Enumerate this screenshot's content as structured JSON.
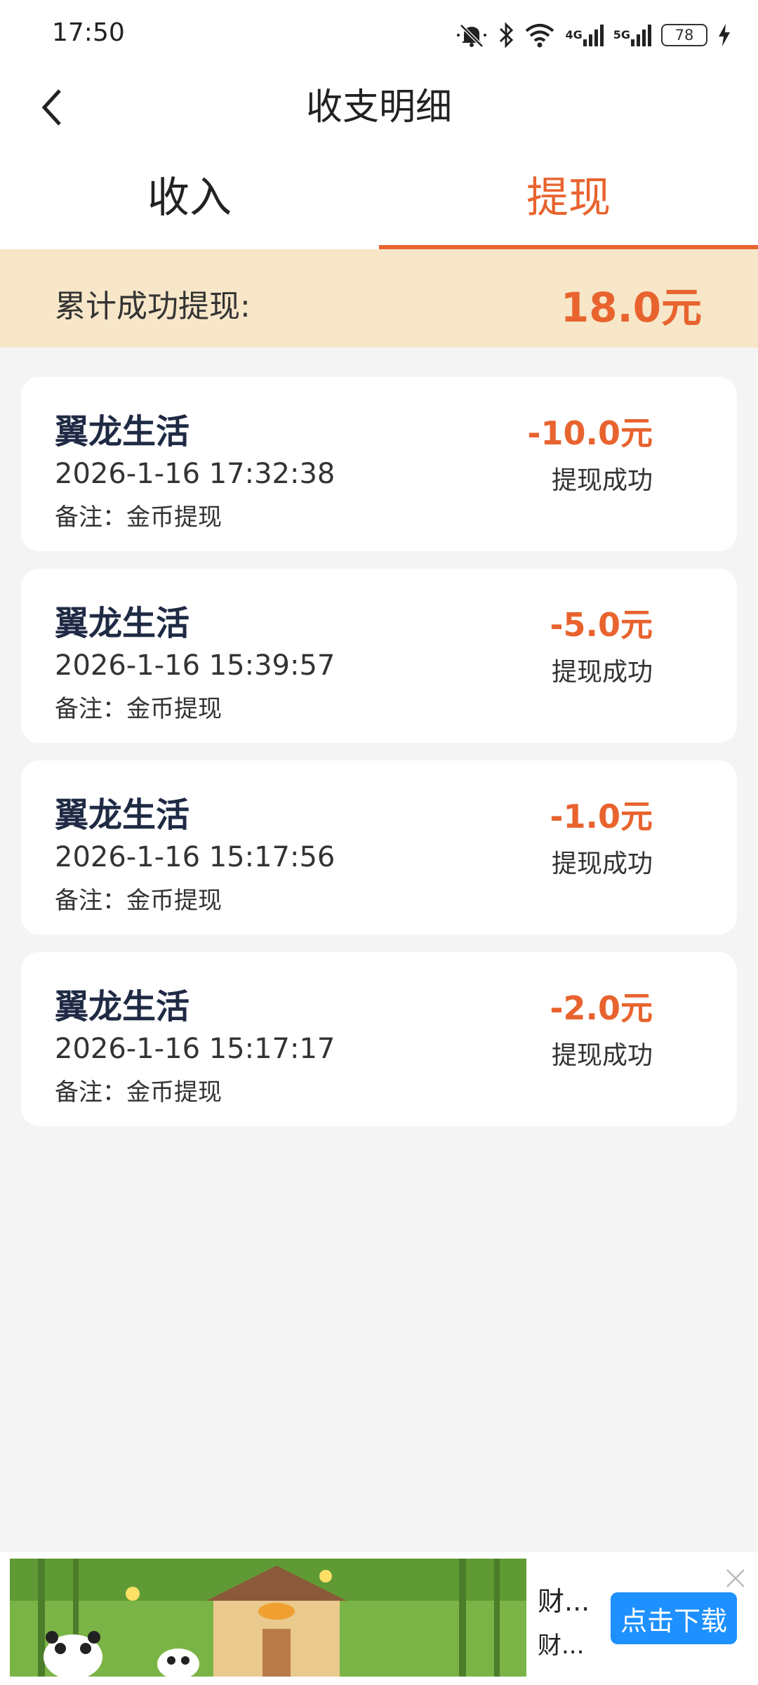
{
  "status_bar": {
    "time": "17:50",
    "battery": "78",
    "net1": "4G",
    "net2": "5G"
  },
  "header": {
    "title": "收支明细"
  },
  "tabs": [
    {
      "label": "收入"
    },
    {
      "label": "提现"
    }
  ],
  "active_tab": "提现",
  "summary": {
    "label": "累计成功提现:",
    "value": "18.0元"
  },
  "records": [
    {
      "name": "翼龙生活",
      "time": "2026-1-16 17:32:38",
      "note": "备注：金币提现",
      "amount": "-10.0元",
      "status": "提现成功"
    },
    {
      "name": "翼龙生活",
      "time": "2026-1-16 15:39:57",
      "note": "备注：金币提现",
      "amount": "-5.0元",
      "status": "提现成功"
    },
    {
      "name": "翼龙生活",
      "time": "2026-1-16 15:17:56",
      "note": "备注：金币提现",
      "amount": "-1.0元",
      "status": "提现成功"
    },
    {
      "name": "翼龙生活",
      "time": "2026-1-16 15:17:17",
      "note": "备注：金币提现",
      "amount": "-2.0元",
      "status": "提现成功"
    }
  ],
  "ad": {
    "text1": "财...",
    "text2": "财...",
    "button": "点击下载"
  },
  "colors": {
    "accent": "#e8632e",
    "summary_bg": "#f7e6c8",
    "page_bg": "#f4f4f4",
    "ad_button": "#1e90ff"
  }
}
